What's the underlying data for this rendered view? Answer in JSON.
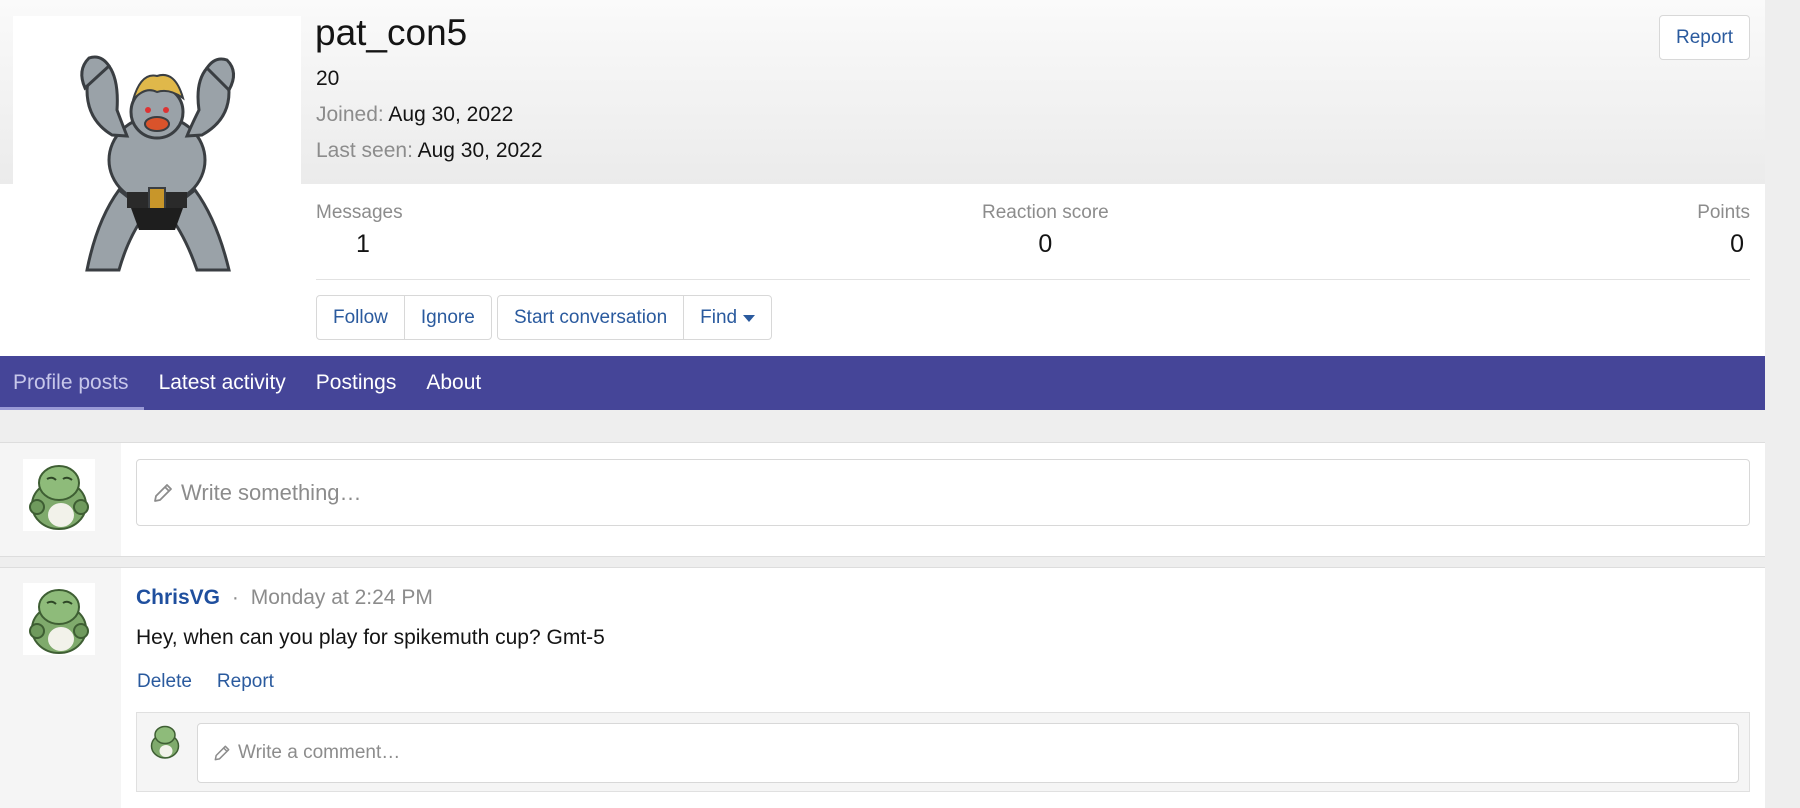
{
  "profile": {
    "username": "pat_con5",
    "user_title": "20",
    "joined_label": "Joined:",
    "joined_value": "Aug 30, 2022",
    "last_seen_label": "Last seen:",
    "last_seen_value": "Aug 30, 2022",
    "report_label": "Report",
    "avatar_icon": "machamp-sprite-avatar"
  },
  "stats": {
    "messages_label": "Messages",
    "messages_value": "1",
    "reaction_label": "Reaction score",
    "reaction_value": "0",
    "points_label": "Points",
    "points_value": "0"
  },
  "actions": {
    "follow": "Follow",
    "ignore": "Ignore",
    "start_conversation": "Start conversation",
    "find": "Find"
  },
  "tabs": [
    {
      "label": "Profile posts",
      "active": true
    },
    {
      "label": "Latest activity",
      "active": false
    },
    {
      "label": "Postings",
      "active": false
    },
    {
      "label": "About",
      "active": false
    }
  ],
  "composer": {
    "placeholder": "Write something…",
    "avatar_icon": "green-pokemon-avatar"
  },
  "post": {
    "author": "ChrisVG",
    "separator": "·",
    "time": "Monday at 2:24 PM",
    "body": "Hey, when can you play for spikemuth cup? Gmt-5",
    "delete_label": "Delete",
    "report_label": "Report",
    "comment_placeholder": "Write a comment…"
  },
  "colors": {
    "tab_bar": "#454598",
    "link": "#2a5a9e",
    "author": "#1f4f9e"
  }
}
